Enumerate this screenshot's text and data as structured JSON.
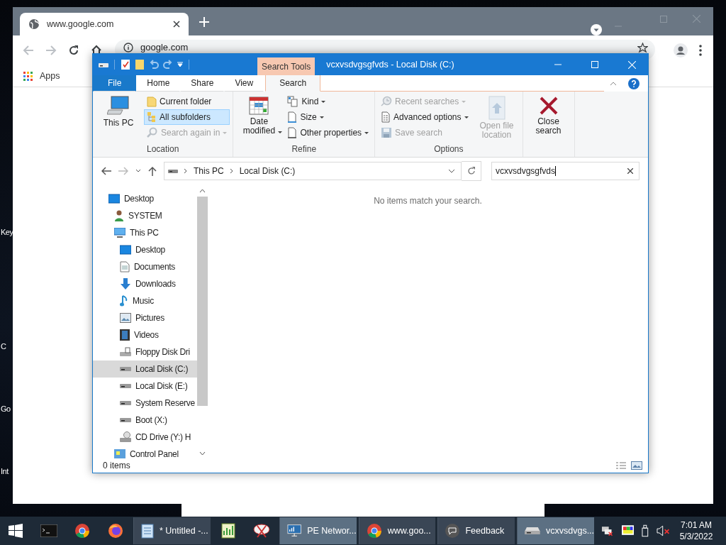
{
  "desktop": {
    "icon_labels": [
      "Key",
      "C",
      "Go",
      "Int"
    ]
  },
  "browser": {
    "tab": {
      "title": "www.google.com"
    },
    "address": "google.com",
    "bookmarks": [
      {
        "label": "Apps"
      }
    ]
  },
  "explorer": {
    "title": "vcxvsdvgsgfvds - Local Disk (C:)",
    "contextual_group": "Search Tools",
    "ribbon_tabs": [
      {
        "label": "File",
        "kind": "file",
        "selected": false
      },
      {
        "label": "Home",
        "kind": "tab",
        "selected": false
      },
      {
        "label": "Share",
        "kind": "tab",
        "selected": false
      },
      {
        "label": "View",
        "kind": "tab",
        "selected": false
      },
      {
        "label": "Search",
        "kind": "contextual",
        "selected": true
      }
    ],
    "ribbon_groups": [
      {
        "name": "Location",
        "items": [
          {
            "label": "This PC",
            "kind": "pc",
            "large": true,
            "disabled": false,
            "selected": false,
            "dropdown": false
          },
          {
            "label": "Current folder",
            "kind": "folder",
            "large": false,
            "disabled": false,
            "selected": false,
            "dropdown": false
          },
          {
            "label": "All subfolders",
            "kind": "subfolders",
            "large": false,
            "disabled": false,
            "selected": true,
            "dropdown": false
          },
          {
            "label": "Search again in",
            "kind": "search-again",
            "large": false,
            "disabled": true,
            "selected": false,
            "dropdown": true
          }
        ]
      },
      {
        "name": "Refine",
        "items": [
          {
            "label": "Date modified",
            "kind": "calendar",
            "large": true,
            "disabled": false,
            "selected": false,
            "dropdown": true
          },
          {
            "label": "Kind",
            "kind": "kind",
            "large": false,
            "disabled": false,
            "selected": false,
            "dropdown": true
          },
          {
            "label": "Size",
            "kind": "size",
            "large": false,
            "disabled": false,
            "selected": false,
            "dropdown": true
          },
          {
            "label": "Other properties",
            "kind": "properties",
            "large": false,
            "disabled": false,
            "selected": false,
            "dropdown": true
          }
        ]
      },
      {
        "name": "Options",
        "items": [
          {
            "label": "Recent searches",
            "kind": "recent",
            "large": false,
            "disabled": true,
            "selected": false,
            "dropdown": true
          },
          {
            "label": "Advanced options",
            "kind": "advanced",
            "large": false,
            "disabled": false,
            "selected": false,
            "dropdown": true
          },
          {
            "label": "Save search",
            "kind": "save",
            "large": false,
            "disabled": true,
            "selected": false,
            "dropdown": false
          },
          {
            "label": "Open file location",
            "kind": "open-location",
            "large": true,
            "disabled": true,
            "selected": false,
            "dropdown": false
          }
        ]
      },
      {
        "items": [
          {
            "label": "Close search",
            "kind": "close",
            "large": true,
            "disabled": false,
            "selected": false,
            "dropdown": false
          }
        ]
      }
    ],
    "breadcrumbs": [
      "This PC",
      "Local Disk (C:)"
    ],
    "search": {
      "value": "vcxvsdvgsgfvds"
    },
    "empty_message": "No items match your search.",
    "nav_tree": [
      {
        "label": "Desktop",
        "kind": "desktop",
        "selected": false,
        "children": [
          {
            "label": "SYSTEM",
            "kind": "user",
            "selected": false
          },
          {
            "label": "This PC",
            "kind": "pc",
            "selected": false,
            "children": [
              {
                "label": "Desktop",
                "kind": "desktop",
                "selected": false
              },
              {
                "label": "Documents",
                "kind": "documents",
                "selected": false
              },
              {
                "label": "Downloads",
                "kind": "downloads",
                "selected": false
              },
              {
                "label": "Music",
                "kind": "music",
                "selected": false
              },
              {
                "label": "Pictures",
                "kind": "pictures",
                "selected": false
              },
              {
                "label": "Videos",
                "kind": "videos",
                "selected": false
              },
              {
                "label": "Floppy Disk Dri",
                "kind": "floppy",
                "selected": false
              },
              {
                "label": "Local Disk (C:)",
                "kind": "drive",
                "selected": true
              },
              {
                "label": "Local Disk (E:)",
                "kind": "drive",
                "selected": false
              },
              {
                "label": "System Reserve",
                "kind": "drive",
                "selected": false
              },
              {
                "label": "Boot (X:)",
                "kind": "drive",
                "selected": false
              },
              {
                "label": "CD Drive (Y:) H",
                "kind": "cd",
                "selected": false
              }
            ]
          },
          {
            "label": "Control Panel",
            "kind": "control",
            "selected": false
          }
        ]
      }
    ],
    "status": "0 items"
  },
  "taskbar": {
    "items": [
      {
        "kind": "terminal",
        "selected": false
      },
      {
        "kind": "chrome",
        "selected": false
      },
      {
        "kind": "firefox",
        "selected": false
      },
      {
        "kind": "notepad",
        "label": "* Untitled -...",
        "selected": false
      },
      {
        "kind": "chart",
        "selected": false
      },
      {
        "kind": "snip",
        "selected": false
      },
      {
        "kind": "network",
        "label": "PE Networ...",
        "selected": true
      },
      {
        "kind": "chrome",
        "label": "www.goo...",
        "selected": false
      },
      {
        "kind": "feedback",
        "label": "Feedback",
        "selected": false
      },
      {
        "kind": "drive",
        "label": "vcxvsdvgs...",
        "selected": true
      }
    ],
    "time": "7:01 AM",
    "date": "5/3/2022"
  }
}
